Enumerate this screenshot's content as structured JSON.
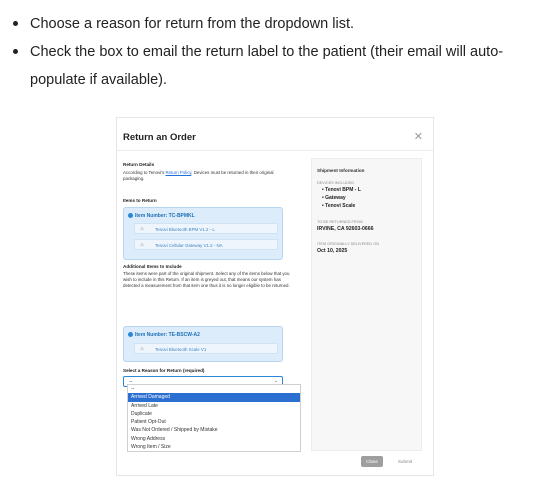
{
  "instructions": [
    "Choose a reason for return from the dropdown list.",
    "Check the box to email the return label to the patient (their email will auto-populate if available)."
  ],
  "modal": {
    "title": "Return an Order",
    "close_icon": "close-icon",
    "return_details": {
      "heading": "Return Details",
      "text_before_link": "According to Tenovi's ",
      "link_text": "Return Policy",
      "text_after_link": ", Devices must be returned in their original packaging."
    },
    "items_heading": "Items to Return",
    "items": [
      {
        "number": "Item Number: TC-BPMKL",
        "rows": [
          "Tenovi Bluetooth BPM V1.2 - L",
          "Tenovi Cellular Gateway V1.2 - NA"
        ]
      },
      {
        "number": "Item Number: TE-BSCW-A2",
        "rows": [
          "Tenovi Bluetooth Scale V1"
        ]
      }
    ],
    "additional": {
      "heading": "Additional Items to Include",
      "text": "These items were part of the original shipment. Select any of the items below that you wish to include in this Return. If an item is greyed out, that means our system has detected a measurement from that item one thus it is no longer eligible to be returned."
    },
    "reason": {
      "label": "Select a Reason for Return (required)",
      "selected": "--",
      "options": [
        "--",
        "Arrived Damaged",
        "Arrived Late",
        "Duplicate",
        "Patient Opt-Out",
        "Was Not Ordered / Shipped by Mistake",
        "Wrong Address",
        "Wrong Item / Size"
      ],
      "highlighted_index": 1
    },
    "shipment": {
      "heading": "Shipment Information",
      "devices_label": "DEVICES INCLUDED",
      "devices": [
        "Tenovi BPM - L",
        "Gateway",
        "Tenovi Scale"
      ],
      "returned_from_label": "TO BE RETURNED FROM",
      "returned_from": "IRVINE, CA 92603-0666",
      "delivered_label": "ITEM ORIGINALLY DELIVERED ON",
      "delivered_on": "Oct 10, 2025"
    },
    "buttons": {
      "close": "Close",
      "submit": "Submit"
    }
  }
}
